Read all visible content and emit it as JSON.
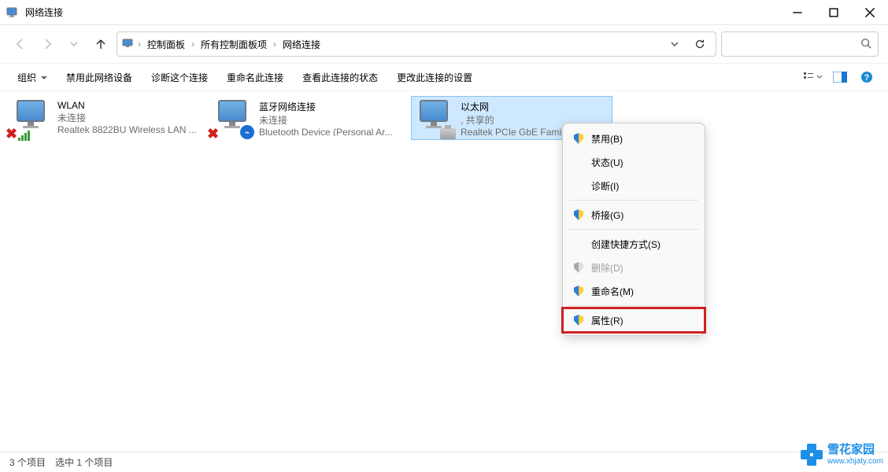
{
  "window": {
    "title": "网络连接"
  },
  "breadcrumbs": {
    "a": "控制面板",
    "b": "所有控制面板项",
    "c": "网络连接"
  },
  "toolbar": {
    "organize": "组织",
    "disable": "禁用此网络设备",
    "diagnose": "诊断这个连接",
    "rename": "重命名此连接",
    "status": "查看此连接的状态",
    "settings": "更改此连接的设置"
  },
  "connections": {
    "wlan": {
      "name": "WLAN",
      "state": "未连接",
      "device": "Realtek 8822BU Wireless LAN ..."
    },
    "bt": {
      "name": "蓝牙网络连接",
      "state": "未连接",
      "device": "Bluetooth Device (Personal Ar..."
    },
    "eth": {
      "name": "以太网",
      "state": ", 共享的",
      "device": "Realtek PCIe GbE Famil..."
    }
  },
  "context_menu": {
    "disable": "禁用(B)",
    "status": "状态(U)",
    "diagnose": "诊断(I)",
    "bridge": "桥接(G)",
    "shortcut": "创建快捷方式(S)",
    "delete": "删除(D)",
    "rename": "重命名(M)",
    "properties": "属性(R)"
  },
  "statusbar": {
    "count": "3 个项目",
    "selected": "选中 1 个项目"
  },
  "watermark": {
    "cn": "雪花家园",
    "en": "www.xhjaty.com"
  },
  "search": {
    "placeholder": ""
  }
}
